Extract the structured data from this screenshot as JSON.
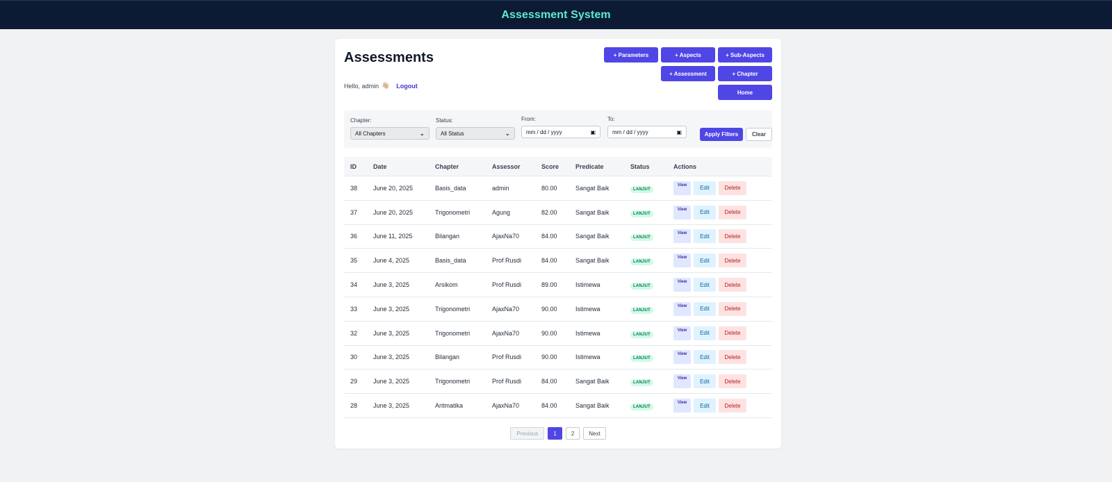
{
  "app": {
    "title": "Assessment System"
  },
  "page": {
    "title": "Assessments",
    "greeting": "Hello, admin",
    "wave": "👋🏼",
    "logout_label": "Logout"
  },
  "toolbar": {
    "parameters_label": "+ Parameters",
    "aspects_label": "+ Aspects",
    "subaspects_label": "+ Sub-Aspects",
    "assessment_label": "+ Assessment",
    "chapter_label": "+ Chapter",
    "home_label": "Home"
  },
  "filters": {
    "chapter_label": "Chapter:",
    "chapter_value": "All Chapters",
    "status_label": "Status:",
    "status_value": "All Status",
    "from_label": "From:",
    "from_value": "mm / dd / yyyy",
    "to_label": "To:",
    "to_value": "mm / dd / yyyy",
    "apply_label": "Apply Filters",
    "clear_label": "Clear"
  },
  "table": {
    "headers": [
      "ID",
      "Date",
      "Chapter",
      "Assessor",
      "Score",
      "Predicate",
      "Status",
      "Actions"
    ],
    "rows": [
      {
        "id": "38",
        "date": "June 20, 2025",
        "chapter": "Basis_data",
        "assessor": "admin",
        "score": "80.00",
        "predicate": "Sangat Baik",
        "status": "LANJUT"
      },
      {
        "id": "37",
        "date": "June 20, 2025",
        "chapter": "Trigonometri",
        "assessor": "Agung",
        "score": "82.00",
        "predicate": "Sangat Baik",
        "status": "LANJUT"
      },
      {
        "id": "36",
        "date": "June 11, 2025",
        "chapter": "Bilangan",
        "assessor": "AjaxNa70",
        "score": "84.00",
        "predicate": "Sangat Baik",
        "status": "LANJUT"
      },
      {
        "id": "35",
        "date": "June 4, 2025",
        "chapter": "Basis_data",
        "assessor": "Prof Rusdi",
        "score": "84.00",
        "predicate": "Sangat Baik",
        "status": "LANJUT"
      },
      {
        "id": "34",
        "date": "June 3, 2025",
        "chapter": "Arsikom",
        "assessor": "Prof Rusdi",
        "score": "89.00",
        "predicate": "Istimewa",
        "status": "LANJUT"
      },
      {
        "id": "33",
        "date": "June 3, 2025",
        "chapter": "Trigonometri",
        "assessor": "AjaxNa70",
        "score": "90.00",
        "predicate": "Istimewa",
        "status": "LANJUT"
      },
      {
        "id": "32",
        "date": "June 3, 2025",
        "chapter": "Trigonometri",
        "assessor": "AjaxNa70",
        "score": "90.00",
        "predicate": "Istimewa",
        "status": "LANJUT"
      },
      {
        "id": "30",
        "date": "June 3, 2025",
        "chapter": "Bilangan",
        "assessor": "Prof Rusdi",
        "score": "90.00",
        "predicate": "Istimewa",
        "status": "LANJUT"
      },
      {
        "id": "29",
        "date": "June 3, 2025",
        "chapter": "Trigonometri",
        "assessor": "Prof Rusdi",
        "score": "84.00",
        "predicate": "Sangat Baik",
        "status": "LANJUT"
      },
      {
        "id": "28",
        "date": "June 3, 2025",
        "chapter": "Aritmatika",
        "assessor": "AjaxNa70",
        "score": "84.00",
        "predicate": "Sangat Baik",
        "status": "LANJUT"
      }
    ],
    "view_label": "View",
    "edit_label": "Edit",
    "delete_label": "Delete"
  },
  "pagination": {
    "previous_label": "Previous",
    "pages": [
      "1",
      "2"
    ],
    "current_page": "1",
    "next_label": "Next"
  },
  "colors": {
    "header_bg": "#0c1a33",
    "title_accent": "#5eead4",
    "primary": "#4f46e5"
  }
}
